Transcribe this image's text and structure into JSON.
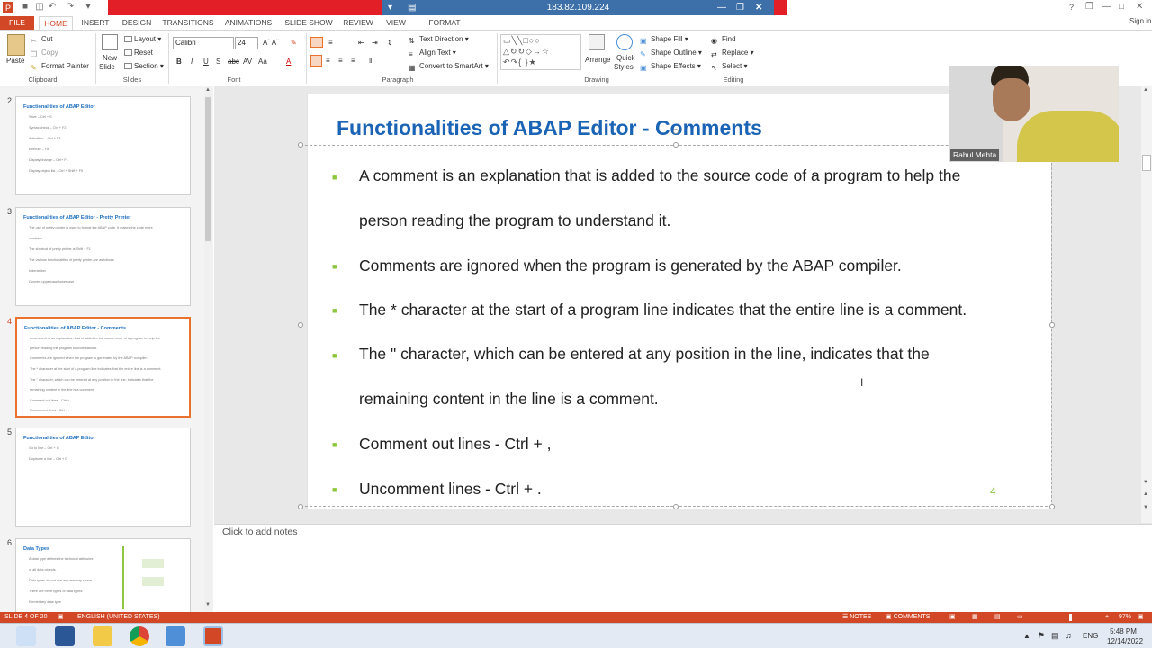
{
  "window": {
    "remote_ip": "183.82.109.224",
    "sign_in": "Sign in",
    "help": "?"
  },
  "tabs": [
    "FILE",
    "HOME",
    "INSERT",
    "DESIGN",
    "TRANSITIONS",
    "ANIMATIONS",
    "SLIDE SHOW",
    "REVIEW",
    "VIEW",
    "FORMAT"
  ],
  "ribbon": {
    "clipboard": {
      "label": "Clipboard",
      "paste": "Paste",
      "cut": "Cut",
      "copy": "Copy",
      "format_painter": "Format Painter"
    },
    "slides": {
      "label": "Slides",
      "new_slide": "New",
      "new_slide2": "Slide",
      "layout": "Layout",
      "reset": "Reset",
      "section": "Section"
    },
    "font": {
      "label": "Font",
      "name": "Calibri",
      "size": "24"
    },
    "paragraph": {
      "label": "Paragraph",
      "text_direction": "Text Direction",
      "align_text": "Align Text",
      "smartart": "Convert to SmartArt"
    },
    "drawing": {
      "label": "Drawing",
      "arrange": "Arrange",
      "quick_styles": "Quick",
      "quick_styles2": "Styles",
      "shape_fill": "Shape Fill",
      "shape_outline": "Shape Outline",
      "shape_effects": "Shape Effects"
    },
    "editing": {
      "label": "Editing",
      "find": "Find",
      "replace": "Replace",
      "select": "Select"
    }
  },
  "thumbnails": [
    {
      "num": "2",
      "title": "Functionalities of ABAP Editor",
      "lines": [
        "Save – Ctrl + S",
        "Syntax check – Ctrl + F2",
        "Activation – Ctrl + F3",
        "Execute – F8",
        "Display/change – Ctrl+ F1",
        "Display object list – Ctrl + Shift + F5"
      ]
    },
    {
      "num": "3",
      "title": "Functionalities of ABAP Editor - Pretty Printer",
      "lines": [
        "The use of pretty printer is used to format the ABAP code. It makes the code more",
        "readable.",
        "The shortcut of pretty printer is Shift + F1",
        "The various functionalities of pretty printer are as follows",
        "Indentation",
        "Convert uppercase/lowercase"
      ]
    },
    {
      "num": "4",
      "title": "Functionalities of ABAP Editor - Comments",
      "lines": [
        "A comment is an explanation that is added to the source code of a program to help the",
        "person reading the program to understand it.",
        "Comments are ignored when the program is generated by the ABAP compiler.",
        "The * character at the start of a program line indicates that the entire line is a comment.",
        "The \" character, which can be entered at any position in the line, indicates that the",
        "remaining content in the line is a comment.",
        "Comment out lines -  Ctrl + ,",
        "Uncomment lines -  Ctrl + ."
      ]
    },
    {
      "num": "5",
      "title": "Functionalities of ABAP Editor",
      "lines": [
        "Go to line – Ctrl + G",
        "Duplicate a line – Ctrl + D"
      ]
    },
    {
      "num": "6",
      "title": "Data Types",
      "lines": [
        "A data type defines the technical attributes",
        "of all data objects.",
        "Data types do not use any memory space.",
        "There are three types of data types:",
        "Elementary data type"
      ]
    }
  ],
  "slide": {
    "title": "Functionalities of ABAP Editor - Comments",
    "bullets": [
      "A comment is an explanation that is added to the source code of a program to help the",
      "person reading the program to understand it.",
      "Comments are ignored when the program is generated by the ABAP compiler.",
      "The * character at the start of a program line indicates that the entire line is a comment.",
      "The \" character, which can be entered at any position in the line, indicates that the",
      "remaining content in the line is a comment.",
      "Comment out lines -   Ctrl + ,",
      "Uncomment lines -  Ctrl + ."
    ],
    "page_number": "4"
  },
  "webcam": {
    "name": "Rahul Mehta"
  },
  "notes": {
    "placeholder": "Click to add notes"
  },
  "status": {
    "slide": "SLIDE 4 OF 20",
    "language": "ENGLISH (UNITED STATES)",
    "notes": "NOTES",
    "comments": "COMMENTS",
    "zoom": "97%"
  },
  "taskbar": {
    "time": "5:48 PM",
    "date": "12/14/2022",
    "lang": "ENG"
  },
  "colors": {
    "accent": "#d24726",
    "title": "#1a63b5",
    "bullet": "#8cc63e"
  }
}
